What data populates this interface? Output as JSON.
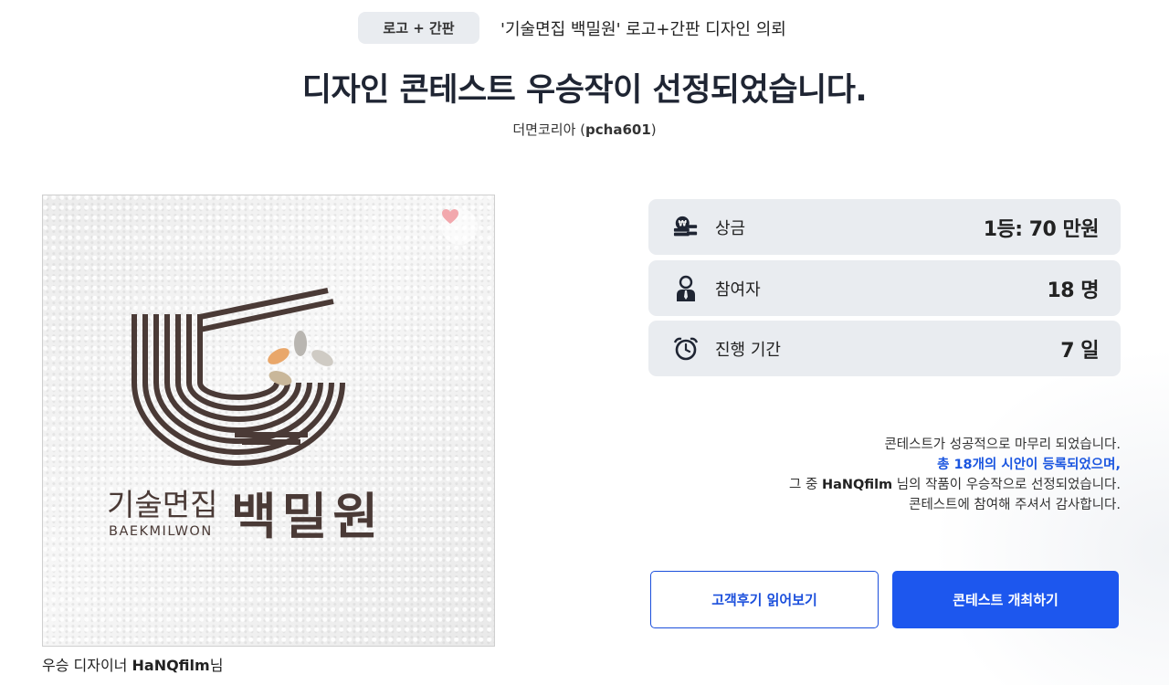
{
  "header": {
    "category_chip": "로고 + 간판",
    "contest_title": "'기술면집 백밀원' 로고+간판 디자인 의뢰",
    "page_title": "디자인 콘테스트 우승작이 선정되었습니다.",
    "client_name": "더면코리아",
    "client_id": "pcha601"
  },
  "image": {
    "logo_text_korean": "기술면집",
    "logo_text_brand": "백밀원",
    "logo_text_english": "BAEKMILWON",
    "like_icon": "heart-icon",
    "colors": {
      "logo_brown": "#4a3a36",
      "leaf_orange": "#e9a76a",
      "leaf_gray": "#b9b6b1",
      "leaf_light": "#d9d4c9",
      "heart": "#f2a8ad"
    }
  },
  "caption": {
    "prefix": "우승 디자이너",
    "designer": "HaNQfilm",
    "suffix": "님"
  },
  "stats": [
    {
      "icon": "prize-money-icon",
      "label": "상금",
      "value": "1등: 70 만원"
    },
    {
      "icon": "participant-icon",
      "label": "참여자",
      "value": "18 명"
    },
    {
      "icon": "alarm-clock-icon",
      "label": "진행 기간",
      "value": "7 일"
    }
  ],
  "message": {
    "line1": "콘테스트가 성공적으로 마무리 되었습니다.",
    "line2": "총 18개의 시안이 등록되었으며,",
    "line3_prefix": "그 중",
    "line3_designer": "HaNQfilm",
    "line3_suffix": "님의 작품이 우승작으로 선정되었습니다.",
    "line4": "콘테스트에 참여해 주셔서 감사합니다."
  },
  "buttons": {
    "reviews": "고객후기 읽어보기",
    "host_contest": "콘테스트 개최하기"
  },
  "colors": {
    "primary": "#1d57ee",
    "chip_bg": "#e9ecf0",
    "title": "#1f2533"
  }
}
